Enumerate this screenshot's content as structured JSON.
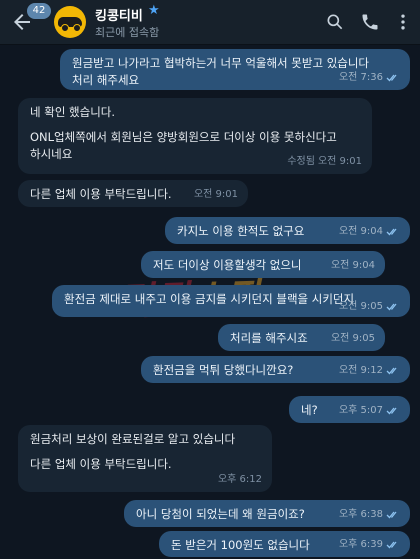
{
  "header": {
    "unread_count": "42",
    "title": "킹콩티비",
    "status": "최근에 접속함"
  },
  "watermark": {
    "part1": "먹튀",
    "part2": "스팟"
  },
  "messages": [
    {
      "dir": "out",
      "lines": [
        "원금받고 나가라고 협박하는거 너무 억울해서 못받고 있습니다",
        "처리 해주세요"
      ],
      "time": "오전 7:36"
    },
    {
      "dir": "in",
      "lines": [
        "네 확인 했습니다.",
        "",
        "ONL업체쪽에서 회원님은 양방회원으로 더이상 이용 못하신다고",
        "하시네요"
      ],
      "edited": "수정됨",
      "time": "오전 9:01"
    },
    {
      "dir": "in",
      "lines": [
        "다른 업체 이용 부탁드립니다."
      ],
      "time": "오전 9:01"
    },
    {
      "dir": "out",
      "lines": [
        "카지노 이용 한적도 없구요"
      ],
      "time": "오전 9:04"
    },
    {
      "dir": "out",
      "lines": [
        "저도 더이상 이용할생각 없으니"
      ],
      "time": "오전 9:04"
    },
    {
      "dir": "out",
      "lines": [
        "환전금 제대로 내주고 이용 금지를 시키던지 블랙을 시키던지"
      ],
      "time": "오전 9:05"
    },
    {
      "dir": "out",
      "lines": [
        "처리를 해주시죠"
      ],
      "time": "오전 9:05"
    },
    {
      "dir": "out",
      "lines": [
        "환전금을 먹튀 당했다니깐요?"
      ],
      "time": "오전 9:12"
    },
    {
      "dir": "out",
      "lines": [
        "네?"
      ],
      "time": "오후 5:07"
    },
    {
      "dir": "in",
      "lines": [
        "원금처리 보상이 완료된걸로 알고 있습니다",
        "",
        "다른 업체 이용 부탁드립니다."
      ],
      "time": "오후 6:12"
    },
    {
      "dir": "out",
      "lines": [
        "아니 당첨이 되었는데 왜 원금이죠?"
      ],
      "time": "오후 6:38"
    },
    {
      "dir": "out",
      "lines": [
        "돈 받은거 100원도 없습니다"
      ],
      "time": "오후 6:39"
    }
  ]
}
